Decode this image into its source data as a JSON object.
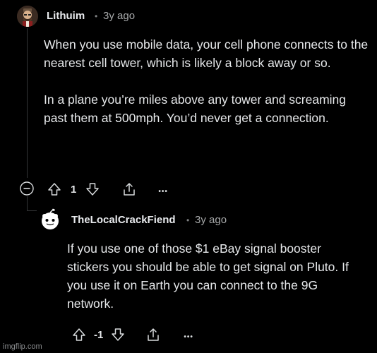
{
  "comments": [
    {
      "username": "Lithuim",
      "separator": "•",
      "time": "3y ago",
      "paragraphs": [
        "When you use mobile data, your cell phone connects to the nearest cell tower, which is likely a block away or so.",
        "In a plane you’re miles above any tower and screaming past them at 500mph. You’d never get a connection."
      ],
      "vote_count": "1",
      "more_label": "•••"
    },
    {
      "username": "TheLocalCrackFiend",
      "separator": "•",
      "time": "3y ago",
      "paragraphs": [
        "If you use one of those $1 eBay signal booster stickers you should be able to get signal on Pluto. If you use it on Earth you can connect to the 9G network."
      ],
      "vote_count": "-1",
      "more_label": "•••"
    }
  ],
  "collapse_symbol": "−",
  "watermark": "imgflip.com",
  "icons": [
    "collapse-icon",
    "upvote-icon",
    "downvote-icon",
    "share-icon",
    "more-icon",
    "avatar-icon"
  ],
  "colors": {
    "background": "#000000",
    "text": "#e6e8ea",
    "muted": "#a8aaab",
    "thread_line": "#343536"
  }
}
